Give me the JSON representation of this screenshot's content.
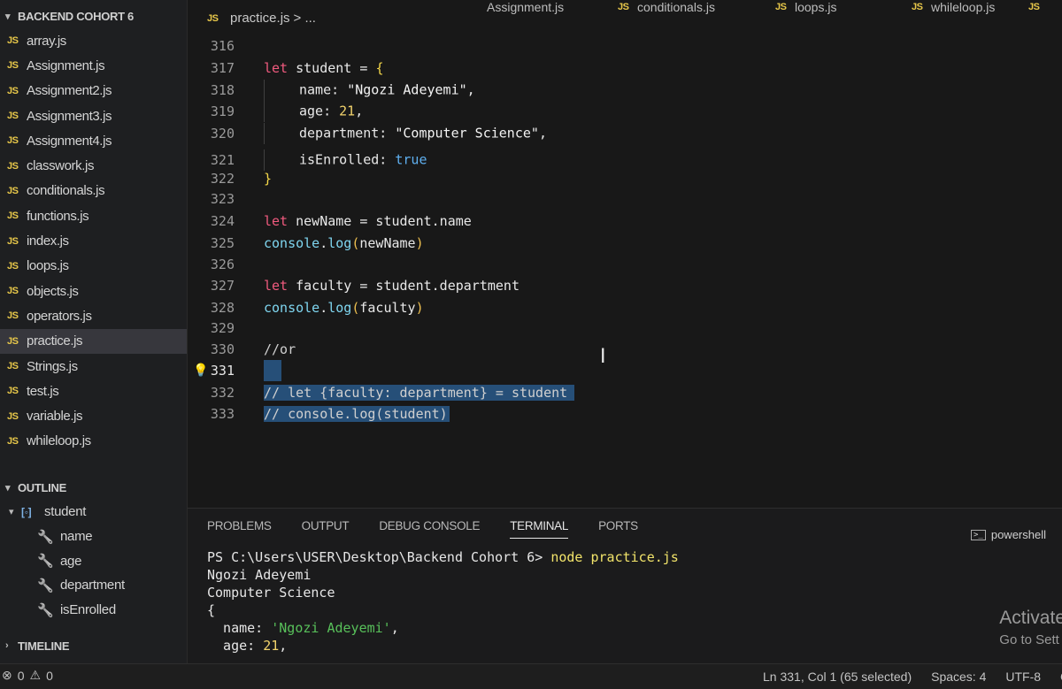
{
  "explorer": {
    "title": "BACKEND COHORT 6",
    "icon_label": "JS",
    "files": [
      "array.js",
      "Assignment.js",
      "Assignment2.js",
      "Assignment3.js",
      "Assignment4.js",
      "classwork.js",
      "conditionals.js",
      "functions.js",
      "index.js",
      "loops.js",
      "objects.js",
      "operators.js",
      "practice.js",
      "Strings.js",
      "test.js",
      "variable.js",
      "whileloop.js"
    ],
    "active_file": "practice.js"
  },
  "outline": {
    "title": "OUTLINE",
    "root": "student",
    "children": [
      "name",
      "age",
      "department",
      "isEnrolled"
    ]
  },
  "timeline": {
    "title": "TIMELINE"
  },
  "tabs": [
    {
      "label": "Assignment.js"
    },
    {
      "label": "conditionals.js"
    },
    {
      "label": "loops.js"
    },
    {
      "label": "whileloop.js"
    }
  ],
  "breadcrumb": {
    "file": "practice.js",
    "rest": "> ..."
  },
  "editor": {
    "lines": [
      {
        "num": "316"
      },
      {
        "num": "317",
        "text": "let student = {"
      },
      {
        "num": "318",
        "text": "name: \"Ngozi Adeyemi\","
      },
      {
        "num": "319",
        "text": "age: 21,"
      },
      {
        "num": "320",
        "text": "department: \"Computer Science\","
      },
      {
        "num": "321",
        "text": "isEnrolled: true"
      },
      {
        "num": "322",
        "text": "}"
      },
      {
        "num": "323"
      },
      {
        "num": "324",
        "text": "let newName = student.name"
      },
      {
        "num": "325",
        "text": "console.log(newName)"
      },
      {
        "num": "326"
      },
      {
        "num": "327",
        "text": "let faculty = student.department"
      },
      {
        "num": "328",
        "text": "console.log(faculty)"
      },
      {
        "num": "329"
      },
      {
        "num": "330",
        "text": "//or"
      },
      {
        "num": "331"
      },
      {
        "num": "332",
        "text": "// let {faculty: department} = student"
      },
      {
        "num": "333",
        "text": "// console.log(student)"
      }
    ]
  },
  "panel": {
    "tabs": [
      "PROBLEMS",
      "OUTPUT",
      "DEBUG CONSOLE",
      "TERMINAL",
      "PORTS"
    ],
    "active_tab": "TERMINAL",
    "shell": "powershell",
    "terminal": {
      "prompt": "PS C:\\Users\\USER\\Desktop\\Backend Cohort 6> ",
      "command": "node practice.js",
      "out1": "Ngozi Adeyemi",
      "out2": "Computer Science",
      "out3": "{",
      "name_key": "  name: ",
      "name_val": "'Ngozi Adeyemi'",
      "age_key": "  age: ",
      "age_val": "21"
    },
    "activate_title": "Activate",
    "activate_sub": "Go to Sett"
  },
  "status": {
    "errors": "0",
    "warnings": "0",
    "position": "Ln 331, Col 1 (65 selected)",
    "spaces": "Spaces: 4",
    "encoding": "UTF-8",
    "eol": "CR"
  }
}
